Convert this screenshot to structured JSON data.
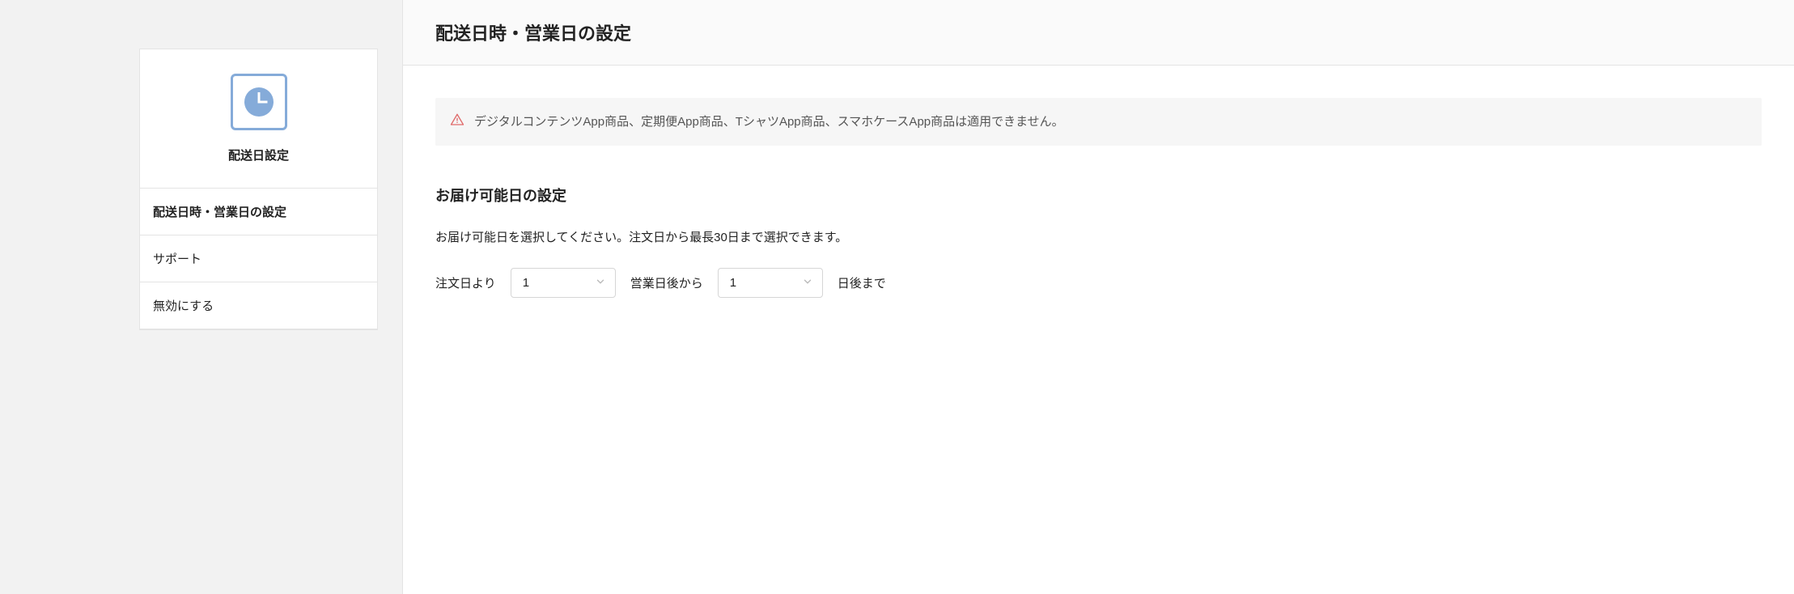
{
  "sidebar": {
    "title": "配送日設定",
    "items": [
      {
        "label": "配送日時・営業日の設定"
      },
      {
        "label": "サポート"
      },
      {
        "label": "無効にする"
      }
    ]
  },
  "main": {
    "header_title": "配送日時・営業日の設定",
    "alert_text": "デジタルコンテンツApp商品、定期便App商品、TシャツApp商品、スマホケースApp商品は適用できません。",
    "section_title": "お届け可能日の設定",
    "section_desc": "お届け可能日を選択してください。注文日から最長30日まで選択できます。",
    "form": {
      "label_before": "注文日より",
      "select_start_value": "1",
      "label_middle": "営業日後から",
      "select_end_value": "1",
      "label_after": "日後まで"
    }
  }
}
